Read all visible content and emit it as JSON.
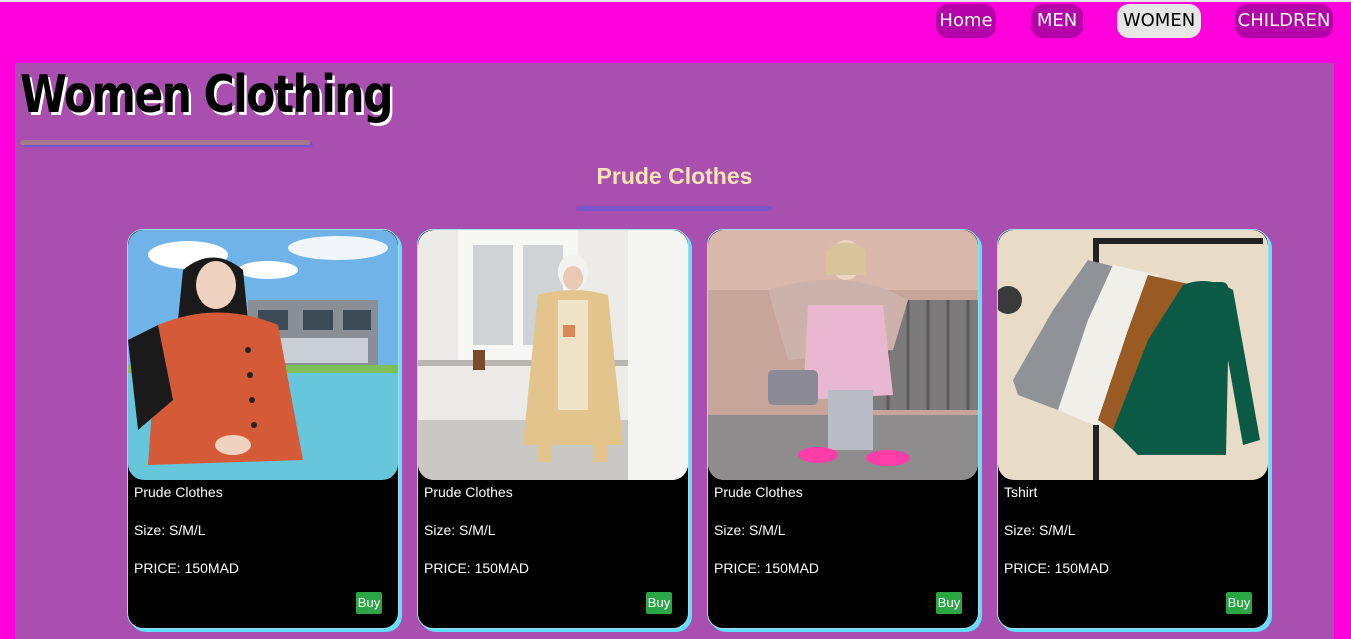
{
  "nav": {
    "items": [
      {
        "label": "Home"
      },
      {
        "label": "MEN"
      },
      {
        "label": "WOMEN",
        "active": true
      },
      {
        "label": "CHILDREN"
      }
    ]
  },
  "page": {
    "title": "Women Clothing",
    "section_heading": "Prude Clothes"
  },
  "products": [
    {
      "name": "Prude Clothes",
      "size": "Size: S/M/L",
      "price": "PRICE: 150MAD",
      "buy_label": "Buy",
      "image": "woman-rust-tunic-hijab-photo"
    },
    {
      "name": "Prude Clothes",
      "size": "Size: S/M/L",
      "price": "PRICE: 150MAD",
      "buy_label": "Buy",
      "image": "woman-beige-coat-photo"
    },
    {
      "name": "Prude Clothes",
      "size": "Size: S/M/L",
      "price": "PRICE: 150MAD",
      "buy_label": "Buy",
      "image": "woman-pink-coat-scarf-photo"
    },
    {
      "name": "Tshirt",
      "size": "Size: S/M/L",
      "price": "PRICE: 150MAD",
      "buy_label": "Buy",
      "image": "turtleneck-sweaters-on-rack-photo"
    }
  ],
  "colors": {
    "page_background": "#ff00dc",
    "content_background": "#a94fb0",
    "nav_button": "#b400a8",
    "nav_active": "#e6e6e6",
    "section_heading": "#ffe4b4",
    "card_background": "#000000",
    "buy_button": "#2aa744"
  }
}
